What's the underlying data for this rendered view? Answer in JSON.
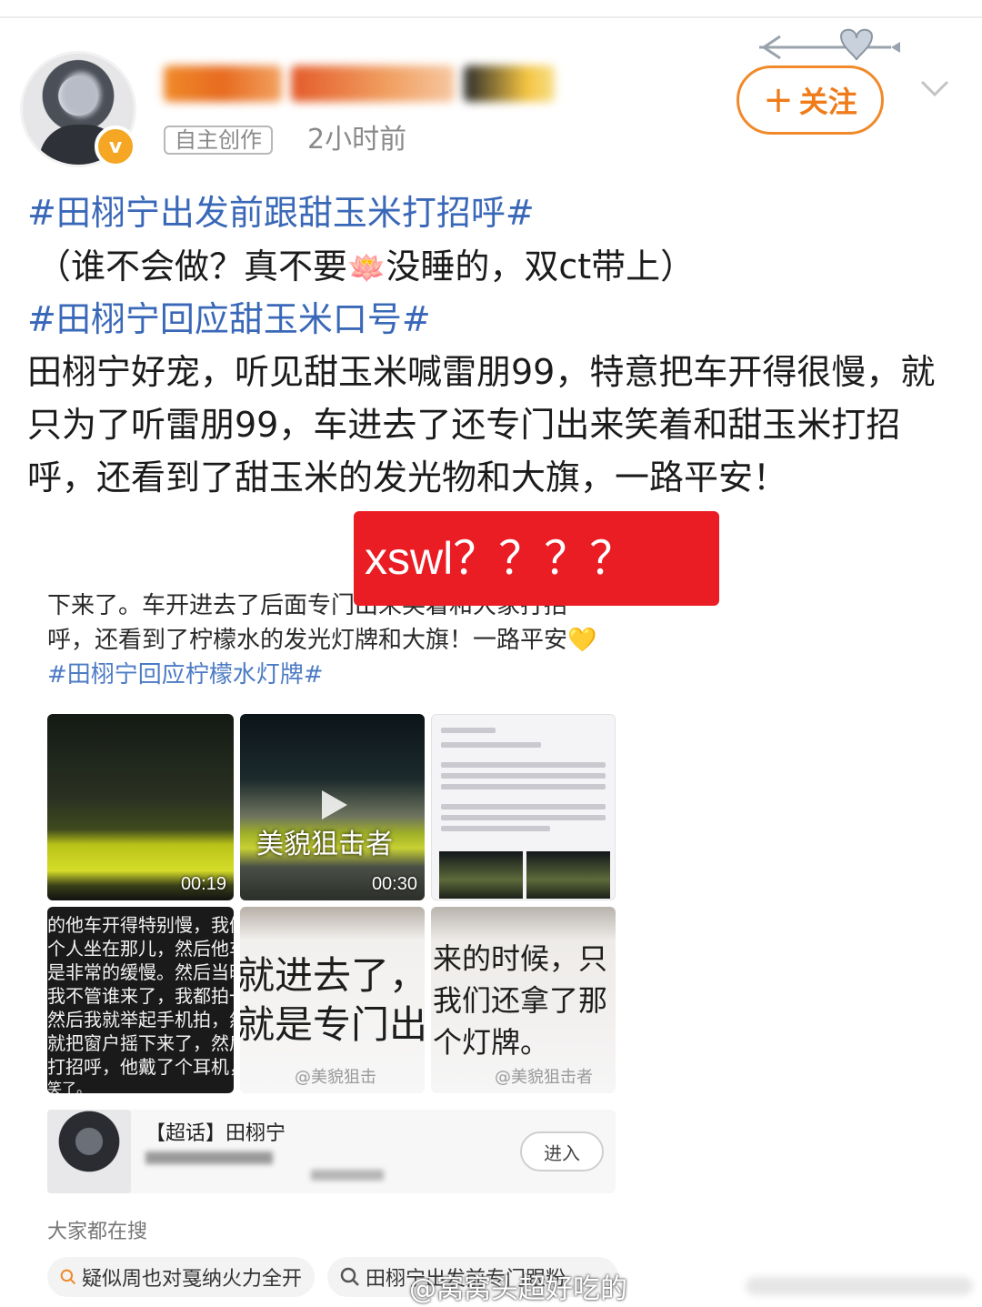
{
  "post": {
    "badge": "自主创作",
    "time": "2小时前",
    "follow_label": "关注",
    "follow_plus": "+",
    "verified_mark": "v"
  },
  "content": {
    "topic1": "#田栩宁出发前跟甜玉米打招呼#",
    "line2_a": "（谁不会做？真不要",
    "line2_emoji": "🪷",
    "line2_b": "没睡的，双ct带上）",
    "topic2": "#田栩宁回应甜玉米口号#",
    "body": "田栩宁好宠，听见甜玉米喊雷朋99，特意把车开得很慢，就只为了听雷朋99，车进去了还专门出来笑着和甜玉米打招呼，还看到了甜玉米的发光物和大旗，一路平安！"
  },
  "annotation": "xswl？？？？",
  "embed": {
    "line1": "下来了。车开进去了后面专门出来笑着和大家打招",
    "line2": "呼，还看到了柠檬水的发光灯牌和大旗！一路平安",
    "line2_emoji": "💛",
    "topic": "#田栩宁回应柠檬水灯牌#",
    "video1_duration": "00:19",
    "video2_duration": "00:30",
    "video2_watermark": "美貌狙击者",
    "thumb4_lines": [
      "的他车开得特别慢，我们看着",
      "个人坐在那儿，然后他车开得",
      "是非常的缓慢。然后当时我",
      "我不管谁来了，我都拍一",
      "然后我就举起手机拍，然",
      "就把窗户摇下来了，然后出",
      "打招呼，他戴了个耳机，然",
      "笑了。"
    ],
    "thumb5_lines": [
      "就进去了，开",
      "就是专门出来"
    ],
    "thumb6_lines": [
      "来的时候，只",
      "我们还拿了那",
      "个灯牌。"
    ],
    "thumb_watermark": "@美貌狙击",
    "thumb6_watermark": "@美貌狙击者",
    "card_title": "【超话】田栩宁",
    "card_enter": "进入",
    "search_heading": "大家都在搜",
    "search_tags": [
      "疑似周也对戛纳火力全开",
      "田栩宁出发前专门跟粉"
    ]
  },
  "footer_watermark": "@窝窝头超好吃的"
}
